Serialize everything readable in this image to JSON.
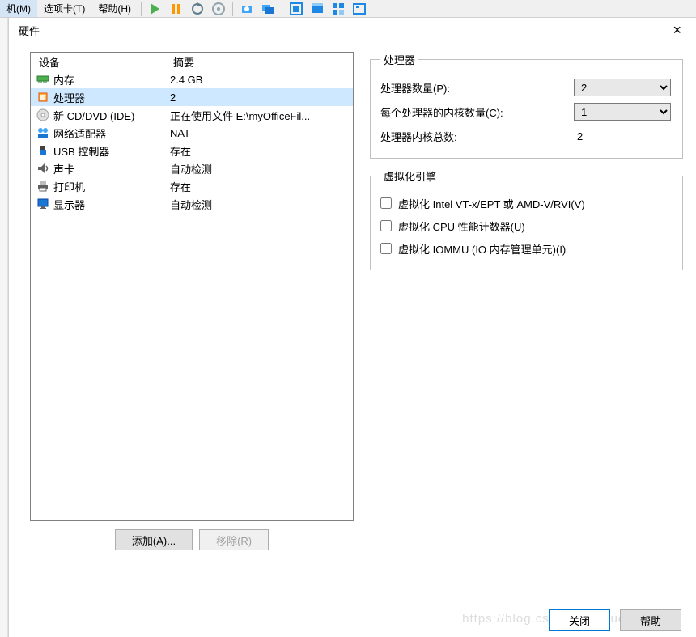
{
  "menubar": {
    "vm": "机(M)",
    "tabs": "选项卡(T)",
    "help": "帮助(H)"
  },
  "dialog": {
    "title": "硬件",
    "close": "×"
  },
  "device_list": {
    "header_device": "设备",
    "header_summary": "摘要",
    "rows": [
      {
        "name": "内存",
        "summary": "2.4 GB",
        "icon": "memory"
      },
      {
        "name": "处理器",
        "summary": "2",
        "icon": "cpu",
        "selected": true
      },
      {
        "name": "新 CD/DVD (IDE)",
        "summary": "正在使用文件 E:\\myOfficeFil...",
        "icon": "disc"
      },
      {
        "name": "网络适配器",
        "summary": "NAT",
        "icon": "network"
      },
      {
        "name": "USB 控制器",
        "summary": "存在",
        "icon": "usb"
      },
      {
        "name": "声卡",
        "summary": "自动检测",
        "icon": "sound"
      },
      {
        "name": "打印机",
        "summary": "存在",
        "icon": "printer"
      },
      {
        "name": "显示器",
        "summary": "自动检测",
        "icon": "display"
      }
    ],
    "add": "添加(A)...",
    "remove": "移除(R)"
  },
  "processors": {
    "legend": "处理器",
    "count_label": "处理器数量(P):",
    "count_value": "2",
    "cores_label": "每个处理器的内核数量(C):",
    "cores_value": "1",
    "total_label": "处理器内核总数:",
    "total_value": "2"
  },
  "virtualization": {
    "legend": "虚拟化引擎",
    "vt": "虚拟化 Intel VT-x/EPT 或 AMD-V/RVI(V)",
    "perf": "虚拟化 CPU 性能计数器(U)",
    "iommu": "虚拟化 IOMMU (IO 内存管理单元)(I)"
  },
  "footer": {
    "close": "关闭",
    "help": "帮助"
  },
  "watermark": "https://blog.csdn.net/luguodehua"
}
